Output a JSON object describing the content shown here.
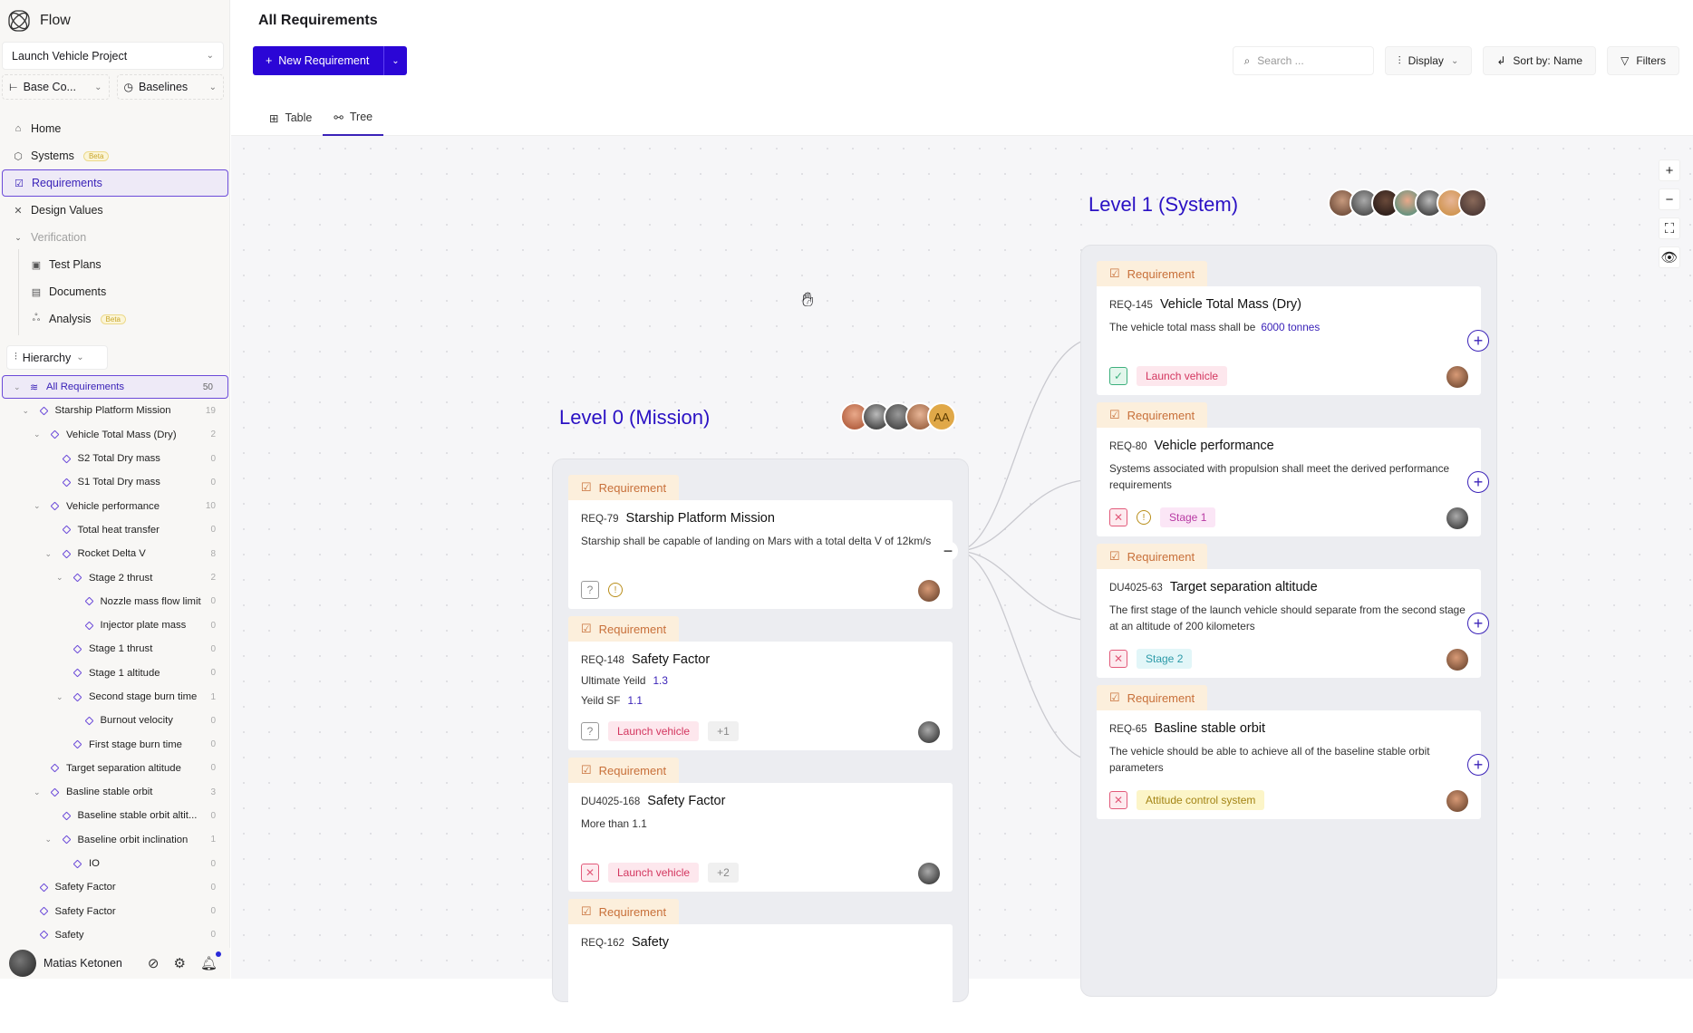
{
  "app": {
    "name": "Flow"
  },
  "sidebar": {
    "project": "Launch Vehicle Project",
    "config_select": "Base Co...",
    "baselines_select": "Baselines",
    "nav": [
      {
        "label": "Home",
        "icon": "home-icon"
      },
      {
        "label": "Systems",
        "icon": "cube-icon",
        "badge": "Beta"
      },
      {
        "label": "Requirements",
        "icon": "checkbox-icon",
        "active": true
      },
      {
        "label": "Design Values",
        "icon": "variable-icon"
      },
      {
        "label": "Verification",
        "icon": "chevron-down-icon",
        "muted": true
      },
      {
        "label": "Test Plans",
        "icon": "clipboard-icon"
      },
      {
        "label": "Documents",
        "icon": "document-icon"
      },
      {
        "label": "Analysis",
        "icon": "graph-icon",
        "badge": "Beta"
      }
    ],
    "hierarchy_label": "Hierarchy",
    "tree": [
      {
        "label": "All Requirements",
        "count": "50",
        "depth": 0,
        "expanded": true,
        "active": true
      },
      {
        "label": "Starship Platform Mission",
        "count": "19",
        "depth": 1,
        "expanded": true
      },
      {
        "label": "Vehicle Total Mass (Dry)",
        "count": "2",
        "depth": 2,
        "expanded": true
      },
      {
        "label": "S2 Total Dry mass",
        "count": "0",
        "depth": 3
      },
      {
        "label": "S1 Total Dry mass",
        "count": "0",
        "depth": 3
      },
      {
        "label": "Vehicle performance",
        "count": "10",
        "depth": 2,
        "expanded": true
      },
      {
        "label": "Total heat transfer",
        "count": "0",
        "depth": 3
      },
      {
        "label": "Rocket Delta V",
        "count": "8",
        "depth": 3,
        "expanded": true
      },
      {
        "label": "Stage 2 thrust",
        "count": "2",
        "depth": 4,
        "expanded": true
      },
      {
        "label": "Nozzle mass flow limit",
        "count": "0",
        "depth": 5
      },
      {
        "label": "Injector plate mass",
        "count": "0",
        "depth": 5
      },
      {
        "label": "Stage 1 thrust",
        "count": "0",
        "depth": 4
      },
      {
        "label": "Stage 1 altitude",
        "count": "0",
        "depth": 4
      },
      {
        "label": "Second stage burn time",
        "count": "1",
        "depth": 4,
        "expanded": true
      },
      {
        "label": "Burnout velocity",
        "count": "0",
        "depth": 5
      },
      {
        "label": "First stage burn time",
        "count": "0",
        "depth": 4
      },
      {
        "label": "Target separation altitude",
        "count": "0",
        "depth": 2
      },
      {
        "label": "Basline stable orbit",
        "count": "3",
        "depth": 2,
        "expanded": true
      },
      {
        "label": "Baseline stable orbit altit...",
        "count": "0",
        "depth": 3
      },
      {
        "label": "Baseline orbit inclination",
        "count": "1",
        "depth": 3,
        "expanded": true
      },
      {
        "label": "IO",
        "count": "0",
        "depth": 4
      },
      {
        "label": "Safety Factor",
        "count": "0",
        "depth": 1
      },
      {
        "label": "Safety Factor",
        "count": "0",
        "depth": 1
      },
      {
        "label": "Safety",
        "count": "0",
        "depth": 1
      }
    ],
    "user": {
      "name": "Matias Ketonen",
      "has_notification": true
    }
  },
  "header": {
    "title": "All Requirements",
    "new_button": "New Requirement",
    "search_placeholder": "Search ...",
    "display": "Display",
    "sort": "Sort by: Name",
    "filters": "Filters",
    "tabs": [
      {
        "label": "Table",
        "active": false
      },
      {
        "label": "Tree",
        "active": true
      }
    ]
  },
  "canvas": {
    "tag_label": "Requirement",
    "level0": {
      "title": "Level 0 (Mission)",
      "extra_avatar": "AA",
      "cards": [
        {
          "id": "REQ-79",
          "name": "Starship Platform Mission",
          "desc": "Starship shall be capable of landing on Mars with a total delta V of 12km/s",
          "status": "unknown",
          "warning": true,
          "chips": []
        },
        {
          "id": "REQ-148",
          "name": "Safety Factor",
          "kv": [
            {
              "k": "Ultimate Yeild",
              "v": "1.3"
            },
            {
              "k": "Yeild SF",
              "v": "1.1"
            }
          ],
          "status": "unknown",
          "chips": [
            {
              "label": "Launch vehicle",
              "kind": "lv"
            },
            {
              "label": "+1",
              "kind": "more"
            }
          ]
        },
        {
          "id": "DU4025-168",
          "name": "Safety Factor",
          "desc": "More than 1.1",
          "status": "failed",
          "chips": [
            {
              "label": "Launch vehicle",
              "kind": "lv"
            },
            {
              "label": "+2",
              "kind": "more"
            }
          ]
        },
        {
          "id": "REQ-162",
          "name": "Safety"
        }
      ]
    },
    "level1": {
      "title": "Level 1 (System)",
      "cards": [
        {
          "id": "REQ-145",
          "name": "Vehicle Total Mass (Dry)",
          "desc": "The vehicle total mass shall be",
          "value": "6000 tonnes",
          "status": "passed",
          "chips": [
            {
              "label": "Launch vehicle",
              "kind": "lv"
            }
          ]
        },
        {
          "id": "REQ-80",
          "name": "Vehicle performance",
          "desc": "Systems associated with propulsion shall meet the derived performance requirements",
          "status": "failed",
          "warning": true,
          "chips": [
            {
              "label": "Stage 1",
              "kind": "s1"
            }
          ]
        },
        {
          "id": "DU4025-63",
          "name": "Target separation altitude",
          "desc": "The first stage of the launch vehicle should separate from the second stage at an altitude of 200 kilometers",
          "status": "failed",
          "chips": [
            {
              "label": "Stage 2",
              "kind": "s2"
            }
          ]
        },
        {
          "id": "REQ-65",
          "name": "Basline stable orbit",
          "desc": "The vehicle should be able to achieve all of the baseline stable orbit parameters",
          "status": "failed",
          "chips": [
            {
              "label": "Attitude control system",
              "kind": "acs"
            }
          ]
        }
      ]
    }
  }
}
